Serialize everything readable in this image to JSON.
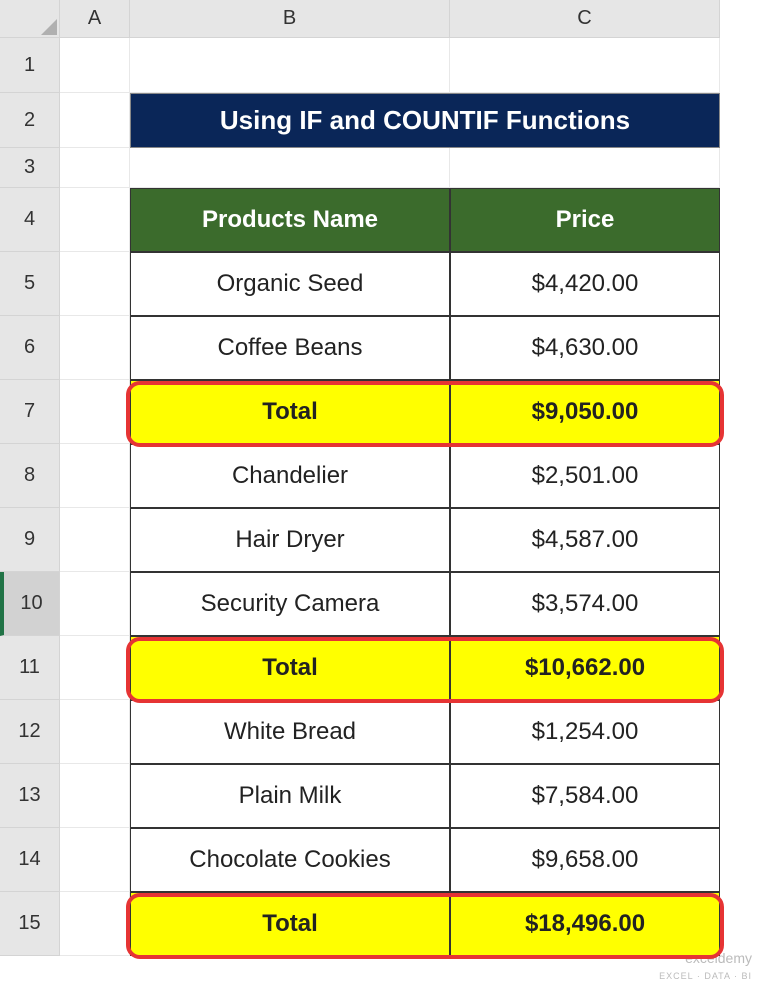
{
  "columns": [
    "A",
    "B",
    "C"
  ],
  "row_numbers": [
    "1",
    "2",
    "3",
    "4",
    "5",
    "6",
    "7",
    "8",
    "9",
    "10",
    "11",
    "12",
    "13",
    "14",
    "15"
  ],
  "selected_row": "10",
  "title": "Using IF and COUNTIF Functions",
  "table": {
    "headers": {
      "name": "Products Name",
      "price": "Price"
    },
    "rows": [
      {
        "name": "Organic Seed",
        "price": "$4,420.00",
        "total": false
      },
      {
        "name": "Coffee Beans",
        "price": "$4,630.00",
        "total": false
      },
      {
        "name": "Total",
        "price": "$9,050.00",
        "total": true
      },
      {
        "name": "Chandelier",
        "price": "$2,501.00",
        "total": false
      },
      {
        "name": "Hair Dryer",
        "price": "$4,587.00",
        "total": false
      },
      {
        "name": "Security Camera",
        "price": "$3,574.00",
        "total": false
      },
      {
        "name": "Total",
        "price": "$10,662.00",
        "total": true
      },
      {
        "name": "White Bread",
        "price": "$1,254.00",
        "total": false
      },
      {
        "name": "Plain Milk",
        "price": "$7,584.00",
        "total": false
      },
      {
        "name": "Chocolate Cookies",
        "price": "$9,658.00",
        "total": false
      },
      {
        "name": "Total",
        "price": "$18,496.00",
        "total": true
      }
    ]
  },
  "watermark": {
    "brand": "exceldemy",
    "tag": "EXCEL · DATA · BI"
  },
  "highlight_rows": [
    7,
    11,
    15
  ]
}
